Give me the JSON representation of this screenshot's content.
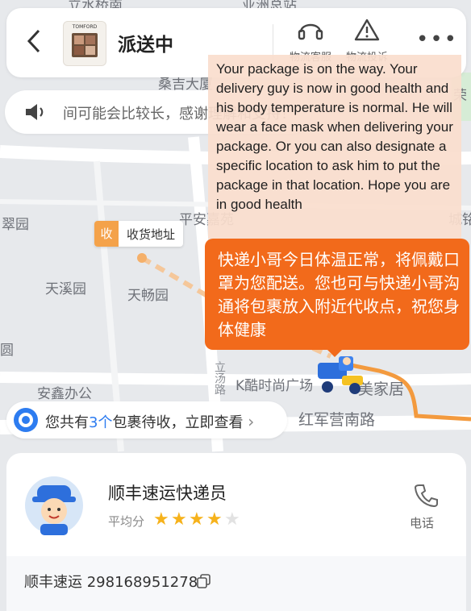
{
  "header": {
    "back_icon": "chevron-left-icon",
    "status_title": "派送中",
    "product_thumb_text": "TOMFORD",
    "service_label": "物流客服",
    "complaint_label": "物流投诉",
    "more_icon": "more-icon"
  },
  "notice": {
    "text": "间可能会比较长，感谢理解和支持！"
  },
  "translation_overlay": {
    "text": "Your package is on the way. Your delivery guy is now in good health and his body temperature is normal. He will wear a face mask when delivering your package. Or you can also designate a specific location to ask him to put the package in that location. Hope you are in good health"
  },
  "courier_bubble": {
    "text": "快递小哥今日体温正常，将佩戴口罩为您配送。您也可与快递小哥沟通将包裹放入附近代收点，祝您身体健康"
  },
  "map": {
    "receive_tag": "收",
    "receive_label": "收货地址",
    "places": {
      "top_left": "立水桥南",
      "top_mid": "亚洲总站",
      "left1": "翠园",
      "mid_top": "平安嘉苑",
      "right1": "城铭",
      "left2": "天溪园",
      "mid2": "天畅园",
      "left3": "安鑫办公",
      "plaza": "K酷时尚广场",
      "home": "美家居",
      "road_bottom": "红军营南路",
      "road_vertical": "立汤路",
      "road_top": "桑吉大厦",
      "far_right": "荣",
      "edge_left": "圆"
    }
  },
  "pending_banner": {
    "prefix": "您共有",
    "count": "3个",
    "suffix": "包裹待收，立即查看",
    "arrow": "›"
  },
  "courier_card": {
    "name": "顺丰速运快递员",
    "rating_label": "平均分",
    "rating_stars": 4,
    "rating_max": 5,
    "phone_label": "电话",
    "waybill_text": "顺丰速运 298168951278",
    "copy_icon": "copy-icon"
  },
  "colors": {
    "accent_orange": "#f26a1b",
    "route_orange": "#f5a64a",
    "link_blue": "#2d7cf0",
    "star_gold": "#f6b21b"
  }
}
